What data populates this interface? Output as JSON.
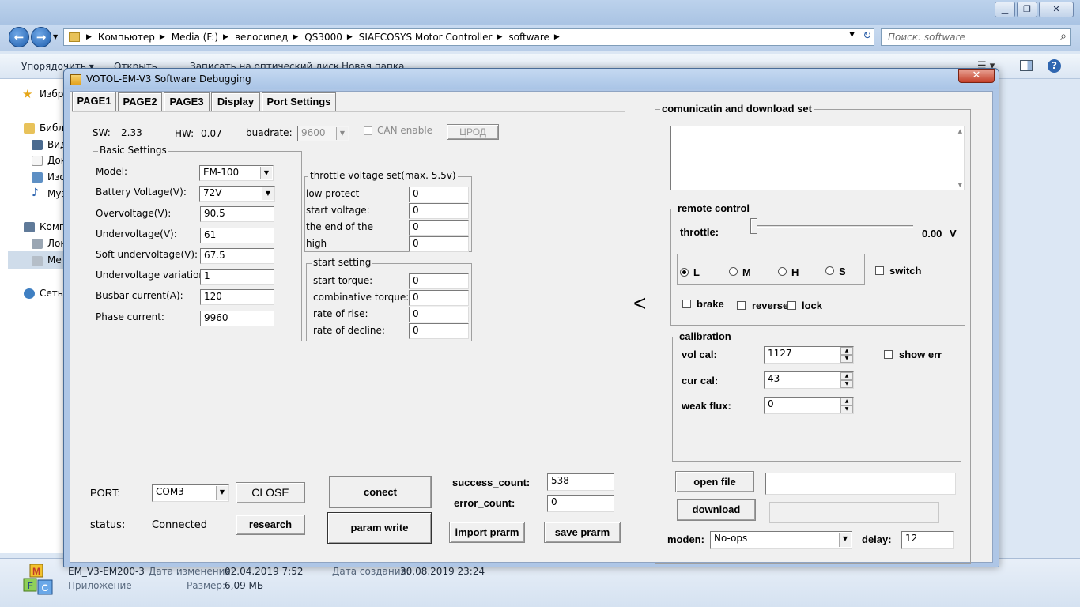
{
  "explorer": {
    "breadcrumb": [
      "Компьютер",
      "Media (F:)",
      "велосипед",
      "QS3000",
      "SIAECOSYS Motor Controller",
      "software"
    ],
    "search_placeholder": "Поиск: software",
    "toolbar": [
      "Упорядочить ▾",
      "Открыть",
      "Записать на оптический диск",
      "Новая папка"
    ],
    "sidebar": [
      "Избр",
      "Библ",
      "Вид",
      "Док",
      "Изо",
      "Муз",
      "Комп",
      "Лок",
      "Ме",
      "Сеть"
    ],
    "status": {
      "file_name": "EM_V3-EM200-3",
      "modified_label": "Дата изменения:",
      "modified_value": "02.04.2019 7:52",
      "created_label": "Дата создания:",
      "created_value": "30.08.2019 23:24",
      "type": "Приложение",
      "size_label": "Размер:",
      "size_value": "6,09 МБ"
    }
  },
  "dialog": {
    "title": "VOTOL-EM-V3 Software Debugging",
    "close": "✕",
    "tabs": [
      "PAGE1",
      "PAGE2",
      "PAGE3",
      "Display",
      "Port Settings"
    ],
    "sw_label": "SW:",
    "sw_value": "2.33",
    "hw_label": "HW:",
    "hw_value": "0.07",
    "baudrate_label": "buadrate:",
    "baudrate_value": "9600",
    "can_label": "CAN enable",
    "upgrade_btn": "ЦРОД",
    "basic": {
      "title": "Basic Settings",
      "rows": [
        {
          "label": "Model:",
          "value": "EM-100"
        },
        {
          "label": "Battery Voltage(V):",
          "value": "72V"
        },
        {
          "label": "Overvoltage(V):",
          "value": "90.5"
        },
        {
          "label": "Undervoltage(V):",
          "value": "61"
        },
        {
          "label": "Soft undervoltage(V):",
          "value": "67.5"
        },
        {
          "label": "Undervoltage variation:",
          "value": "1"
        },
        {
          "label": "Busbar current(A):",
          "value": "120"
        },
        {
          "label": "Phase current:",
          "value": "9960"
        }
      ]
    },
    "throttle": {
      "title": "throttle voltage set(max. 5.5v)",
      "rows": [
        {
          "label": "low protect",
          "value": "0"
        },
        {
          "label": "start voltage:",
          "value": "0"
        },
        {
          "label": "the end of the",
          "value": "0"
        },
        {
          "label": "high",
          "value": "0"
        }
      ]
    },
    "start": {
      "title": "start setting",
      "rows": [
        {
          "label": "start torque:",
          "value": "0"
        },
        {
          "label": "combinative torque:",
          "value": "0"
        },
        {
          "label": "rate of rise:",
          "value": "0"
        },
        {
          "label": "rate of decline:",
          "value": "0"
        }
      ]
    },
    "port_label": "PORT:",
    "port_value": "COM3",
    "close_btn": "CLOSE",
    "status_label": "status:",
    "status_value": "Connected",
    "research_btn": "research",
    "connect_btn": "conect",
    "param_write_btn": "param write",
    "success_label": "success_count:",
    "success_value": "538",
    "error_label": "error_count:",
    "error_value": "0",
    "import_btn": "import prarm",
    "save_btn": "save prarm",
    "collapse_arrow": "<",
    "comm": {
      "title": "comunicatin and download set",
      "remote_title": "remote control",
      "throttle_label": "throttle:",
      "throttle_value": "0.00",
      "throttle_unit": "V",
      "throttle_level": 0.0,
      "modes": [
        "L",
        "M",
        "H",
        "S"
      ],
      "mode_selected": "L",
      "switch_label": "switch",
      "brake_label": "brake",
      "reverse_label": "reverse",
      "lock_label": "lock",
      "cal_title": "calibration",
      "vol_label": "vol cal:",
      "vol_value": "1127",
      "cur_label": "cur cal:",
      "cur_value": "43",
      "weak_label": "weak flux:",
      "weak_value": "0",
      "show_err_label": "show err",
      "open_file_btn": "open file",
      "download_btn": "download",
      "moden_label": "moden:",
      "moden_value": "No-ops",
      "delay_label": "delay:",
      "delay_value": "12"
    }
  },
  "colors": {
    "window_frame": "#aec6e6",
    "client_bg": "#f0f0f0",
    "close_red": "#c4402a"
  }
}
